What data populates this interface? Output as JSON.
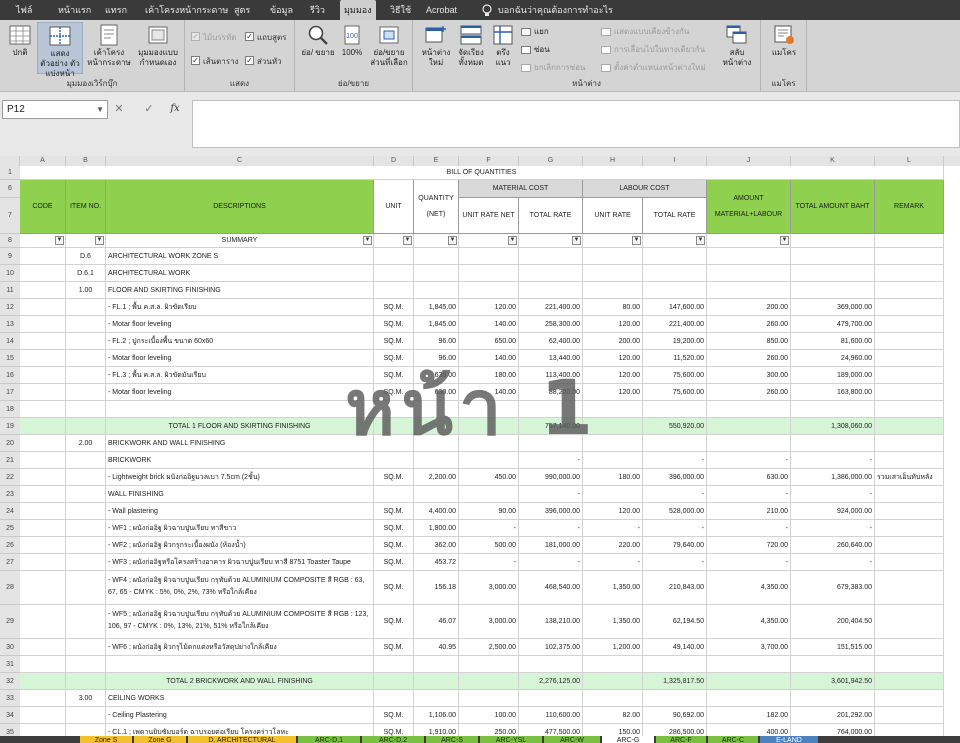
{
  "ribbon_tabs": [
    "ไฟล์",
    "หน้าแรก",
    "แทรก",
    "เค้าโครงหน้ากระดาษ",
    "สูตร",
    "ข้อมูล",
    "รีวิว",
    "มุมมอง",
    "วิธีใช้",
    "Acrobat"
  ],
  "active_tab": "มุมมอง",
  "tell_me": "บอกฉันว่าคุณต้องการทำอะไร",
  "groups": {
    "workbook_views": {
      "label": "มุมมองเวิร์กบุ๊ก",
      "normal": "ปกติ",
      "page_break": "แสดงตัวอย่าง ตัวแบ่งหน้า",
      "page_layout": "เค้าโครง หน้ากระดาษ",
      "custom_views": "มุมมองแบบ กำหนดเอง"
    },
    "show": {
      "label": "แสดง",
      "ruler": "ไม้บรรทัด",
      "formula_bar": "แถบสูตร",
      "gridlines": "เส้นตาราง",
      "headings": "ส่วนหัว"
    },
    "zoom": {
      "label": "ย่อ/ขยาย",
      "zoom": "ย่อ/ ขยาย",
      "hundred": "100%",
      "zoom_to_selection": "ย่อ/ขยาย ส่วนที่เลือก"
    },
    "window": {
      "label": "หน้าต่าง",
      "new_window": "หน้าต่าง ใหม่",
      "arrange_all": "จัดเรียง ทั้งหมด",
      "freeze": "ตรึง แนว",
      "split": "แยก",
      "hide": "ซ่อน",
      "unhide": "ยกเลิกการซ่อน",
      "side_by_side": "แสดงแบบเคียงข้างกัน",
      "sync_scroll": "การเลื่อนไปในทางเดียวกัน",
      "reset_position": "ตั้งค่าตำแหน่งหน้าต่างใหม่",
      "switch_windows": "สลับ หน้าต่าง"
    },
    "macros": {
      "label": "แมโคร",
      "macros": "แมโคร"
    }
  },
  "formula_bar": {
    "name_box": "P12",
    "fx": "fx",
    "value": ""
  },
  "columns": [
    "A",
    "B",
    "C",
    "D",
    "E",
    "F",
    "G",
    "H",
    "I",
    "J",
    "K",
    "L"
  ],
  "watermark": "หน้า 1",
  "sheet": {
    "title": "BILL OF QUANTITIES",
    "headers": {
      "code": "CODE",
      "item_no": "ITEM NO.",
      "descriptions": "DESCRIPTIONS",
      "unit": "UNIT",
      "quantity": "QUANTITY (NET)",
      "material_cost": "MATERIAL COST",
      "labour_cost": "LABOUR COST",
      "unit_rate_net": "UNIT RATE NET",
      "total_rate": "TOTAL RATE",
      "unit_rate": "UNIT RATE",
      "amount": "AMOUNT MATERIAL+LABOUR",
      "total_amount": "TOTAL AMOUNT BAHT",
      "remark": "REMARK"
    },
    "summary_label": "SUMMARY",
    "rows": [
      {
        "n": "9",
        "b": "D.6",
        "c": "ARCHITECTURAL WORK ZONE S",
        "d": "",
        "e": "",
        "f": "",
        "g": "",
        "h": "",
        "i": "",
        "j": "",
        "k": "",
        "l": ""
      },
      {
        "n": "10",
        "b": "D.6.1",
        "c": "ARCHITECTURAL WORK",
        "d": "",
        "e": "",
        "f": "",
        "g": "",
        "h": "",
        "i": "",
        "j": "",
        "k": "",
        "l": ""
      },
      {
        "n": "11",
        "b": "1.00",
        "c": "FLOOR AND SKIRTING FINISHING",
        "d": "",
        "e": "",
        "f": "",
        "g": "",
        "h": "",
        "i": "",
        "j": "",
        "k": "",
        "l": ""
      },
      {
        "n": "12",
        "b": "",
        "c": "-  FL.1 ; พื้น ค.ส.ล. ผิวขัดเรียบ",
        "d": "SQ.M.",
        "e": "1,845.00",
        "f": "120.00",
        "g": "221,400.00",
        "h": "80.00",
        "i": "147,600.00",
        "j": "200.00",
        "k": "369,000.00",
        "l": ""
      },
      {
        "n": "13",
        "b": "",
        "c": "- Motar floor leveling",
        "d": "SQ.M.",
        "e": "1,845.00",
        "f": "140.00",
        "g": "258,300.00",
        "h": "120.00",
        "i": "221,400.00",
        "j": "260.00",
        "k": "479,700.00",
        "l": ""
      },
      {
        "n": "14",
        "b": "",
        "c": "-  FL.2 ; ปูกระเบื้องพื้น ขนาด 60x60",
        "d": "SQ.M.",
        "e": "96.00",
        "f": "650.00",
        "g": "62,400.00",
        "h": "200.00",
        "i": "19,200.00",
        "j": "850.00",
        "k": "81,600.00",
        "l": ""
      },
      {
        "n": "15",
        "b": "",
        "c": "- Motar floor leveling",
        "d": "SQ.M.",
        "e": "96.00",
        "f": "140.00",
        "g": "13,440.00",
        "h": "120.00",
        "i": "11,520.00",
        "j": "260.00",
        "k": "24,960.00",
        "l": ""
      },
      {
        "n": "16",
        "b": "",
        "c": "-  FL.3 ; พื้น ค.ส.ล. ผิวขัดมันเรียบ",
        "d": "SQ.M.",
        "e": "630.00",
        "f": "180.00",
        "g": "113,400.00",
        "h": "120.00",
        "i": "75,600.00",
        "j": "300.00",
        "k": "189,000.00",
        "l": ""
      },
      {
        "n": "17",
        "b": "",
        "c": "- Motar floor leveling",
        "d": "SQ.M.",
        "e": "630.00",
        "f": "140.00",
        "g": "88,200.00",
        "h": "120.00",
        "i": "75,600.00",
        "j": "260.00",
        "k": "163,800.00",
        "l": ""
      },
      {
        "n": "18",
        "b": "",
        "c": "",
        "d": "",
        "e": "",
        "f": "",
        "g": "",
        "h": "",
        "i": "",
        "j": "",
        "k": "",
        "l": ""
      },
      {
        "n": "19",
        "b": "",
        "c": "TOTAL 1 FLOOR AND SKIRTING FINISHING",
        "d": "",
        "e": "",
        "f": "",
        "g": "757,140.00",
        "h": "",
        "i": "550,920.00",
        "j": "",
        "k": "1,308,060.00",
        "l": "",
        "total": true
      },
      {
        "n": "20",
        "b": "2.00",
        "c": "BRICKWORK AND WALL FINISHING",
        "d": "",
        "e": "",
        "f": "",
        "g": "",
        "h": "",
        "i": "",
        "j": "",
        "k": "",
        "l": ""
      },
      {
        "n": "21",
        "b": "",
        "c": "BRICKWORK",
        "d": "",
        "e": "",
        "f": "",
        "g": "-",
        "h": "",
        "i": "-",
        "j": "-",
        "k": "-",
        "l": ""
      },
      {
        "n": "22",
        "b": "",
        "c": "- Lightweight brick ผนังก่ออิฐมวลเบา 7.5cm (2ชั้น)",
        "d": "SQ.M.",
        "e": "2,200.00",
        "f": "450.00",
        "g": "990,000.00",
        "h": "180.00",
        "i": "396,000.00",
        "j": "630.00",
        "k": "1,386,000.00",
        "l": "รวมเสาเอ็นทับหลัง"
      },
      {
        "n": "23",
        "b": "",
        "c": "WALL FINISHING",
        "d": "",
        "e": "",
        "f": "",
        "g": "-",
        "h": "",
        "i": "-",
        "j": "-",
        "k": "-",
        "l": ""
      },
      {
        "n": "24",
        "b": "",
        "c": "- Wall plastering",
        "d": "SQ.M.",
        "e": "4,400.00",
        "f": "90.00",
        "g": "396,000.00",
        "h": "120.00",
        "i": "528,000.00",
        "j": "210.00",
        "k": "924,000.00",
        "l": ""
      },
      {
        "n": "25",
        "b": "",
        "c": "- WF1 ; ผนังก่ออิฐ ผิวฉาบปูนเรียบ ทาสีขาว",
        "d": "SQ.M.",
        "e": "1,800.00",
        "f": "-",
        "g": "-",
        "h": "-",
        "i": "-",
        "j": "-",
        "k": "-",
        "l": ""
      },
      {
        "n": "26",
        "b": "",
        "c": "- WF2 ; ผนังก่ออิฐ ผิวกรุกระเบื้องผนัง (ห้องน้ำ)",
        "d": "SQ.M.",
        "e": "362.00",
        "f": "500.00",
        "g": "181,000.00",
        "h": "220.00",
        "i": "79,640.00",
        "j": "720.00",
        "k": "260,640.00",
        "l": ""
      },
      {
        "n": "27",
        "b": "",
        "c": "- WF3 ; ผนังก่ออิฐหรือโครงสร้างอาคาร ผิวฉาบปูนเรียบ ทาสี 8751 Toaster Taupe",
        "d": "SQ.M.",
        "e": "453.72",
        "f": "-",
        "g": "-",
        "h": "-",
        "i": "-",
        "j": "-",
        "k": "-",
        "l": ""
      },
      {
        "n": "28",
        "b": "",
        "c": "- WF4 ; ผนังก่ออิฐ ผิวฉาบปูนเรียบ กรุทับด้วย ALUMINIUM COMPOSITE สี RGB : 63, 67, 65 - CMYK : 5%, 0%, 2%, 73% หรือใกล้เคียง",
        "d": "SQ.M.",
        "e": "156.18",
        "f": "3,000.00",
        "g": "468,540.00",
        "h": "1,350.00",
        "i": "210,843.00",
        "j": "4,350.00",
        "k": "679,383.00",
        "l": "",
        "tall": true
      },
      {
        "n": "29",
        "b": "",
        "c": "- WF5 ; ผนังก่ออิฐ ผิวฉาบปูนเรียบ กรุทับด้วย ALUMINIUM COMPOSITE สี RGB : 123, 106, 97 - CMYK : 0%, 13%, 21%, 51% หรือใกล้เคียง",
        "d": "SQ.M.",
        "e": "46.07",
        "f": "3,000.00",
        "g": "138,210.00",
        "h": "1,350.00",
        "i": "62,194.50",
        "j": "4,350.00",
        "k": "200,404.50",
        "l": "",
        "tall": true
      },
      {
        "n": "30",
        "b": "",
        "c": "- WF6 ; ผนังก่ออิฐ ผิวกรุไม้ตกแต่งหรือวัสดุปย่างใกล้เคียง",
        "d": "SQ.M.",
        "e": "40.95",
        "f": "2,500.00",
        "g": "102,375.00",
        "h": "1,200.00",
        "i": "49,140.00",
        "j": "3,700.00",
        "k": "151,515.00",
        "l": ""
      },
      {
        "n": "31",
        "b": "",
        "c": "",
        "d": "",
        "e": "",
        "f": "",
        "g": "",
        "h": "",
        "i": "",
        "j": "",
        "k": "",
        "l": ""
      },
      {
        "n": "32",
        "b": "",
        "c": "TOTAL 2 BRICKWORK AND WALL FINISHING",
        "d": "",
        "e": "",
        "f": "",
        "g": "2,276,125.00",
        "h": "",
        "i": "1,325,817.50",
        "j": "",
        "k": "3,601,942.50",
        "l": "",
        "total": true
      },
      {
        "n": "33",
        "b": "3.00",
        "c": "CEILING WORKS",
        "d": "",
        "e": "",
        "f": "",
        "g": "",
        "h": "",
        "i": "",
        "j": "",
        "k": "",
        "l": ""
      },
      {
        "n": "34",
        "b": "",
        "c": "- Ceiling Plastering",
        "d": "SQ.M.",
        "e": "1,106.00",
        "f": "100.00",
        "g": "110,600.00",
        "h": "82.00",
        "i": "90,692.00",
        "j": "182.00",
        "k": "201,292.00",
        "l": ""
      },
      {
        "n": "35",
        "b": "",
        "c": "- CL.1 ; เพดานยิบซัมบอร์ด ฉาบรอยต่อเรียบ โครงคร่าวโลหะ",
        "d": "SQ.M.",
        "e": "1,910.00",
        "f": "250.00",
        "g": "477,500.00",
        "h": "150.00",
        "i": "286,500.00",
        "j": "400.00",
        "k": "764,000.00",
        "l": ""
      }
    ]
  },
  "sheet_tabs": [
    {
      "label": "Zone S",
      "color": "#f2c12e"
    },
    {
      "label": "Zone G",
      "color": "#f2c12e"
    },
    {
      "label": "D. ARCHITECTURAL",
      "color": "#f2c12e"
    },
    {
      "label": "ARC-D.1",
      "color": "#7ac143"
    },
    {
      "label": "ARC-D.2",
      "color": "#7ac143"
    },
    {
      "label": "ARC-S",
      "color": "#7ac143"
    },
    {
      "label": "ARC-YSL",
      "color": "#7ac143"
    },
    {
      "label": "ARC-W",
      "color": "#7ac143"
    },
    {
      "label": "ARC-G",
      "color": "#ffffff"
    },
    {
      "label": "ARC-F",
      "color": "#7ac143"
    },
    {
      "label": "ARC-C",
      "color": "#7ac143"
    },
    {
      "label": "E-LAND",
      "color": "#4f81bd"
    }
  ]
}
